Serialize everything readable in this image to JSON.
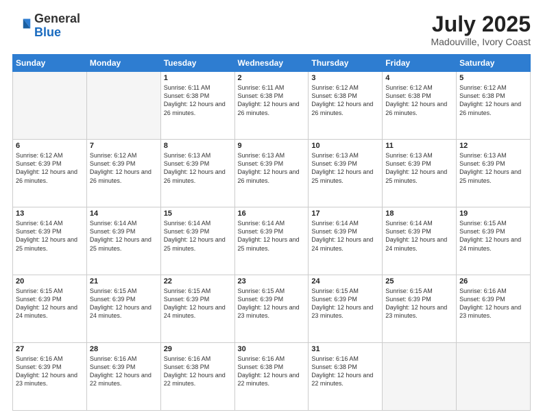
{
  "header": {
    "logo": {
      "general": "General",
      "blue": "Blue"
    },
    "title": "July 2025",
    "location": "Madouville, Ivory Coast"
  },
  "weekdays": [
    "Sunday",
    "Monday",
    "Tuesday",
    "Wednesday",
    "Thursday",
    "Friday",
    "Saturday"
  ],
  "weeks": [
    [
      {
        "day": null,
        "info": null
      },
      {
        "day": null,
        "info": null
      },
      {
        "day": "1",
        "info": "Sunrise: 6:11 AM\nSunset: 6:38 PM\nDaylight: 12 hours and 26 minutes."
      },
      {
        "day": "2",
        "info": "Sunrise: 6:11 AM\nSunset: 6:38 PM\nDaylight: 12 hours and 26 minutes."
      },
      {
        "day": "3",
        "info": "Sunrise: 6:12 AM\nSunset: 6:38 PM\nDaylight: 12 hours and 26 minutes."
      },
      {
        "day": "4",
        "info": "Sunrise: 6:12 AM\nSunset: 6:38 PM\nDaylight: 12 hours and 26 minutes."
      },
      {
        "day": "5",
        "info": "Sunrise: 6:12 AM\nSunset: 6:38 PM\nDaylight: 12 hours and 26 minutes."
      }
    ],
    [
      {
        "day": "6",
        "info": "Sunrise: 6:12 AM\nSunset: 6:39 PM\nDaylight: 12 hours and 26 minutes."
      },
      {
        "day": "7",
        "info": "Sunrise: 6:12 AM\nSunset: 6:39 PM\nDaylight: 12 hours and 26 minutes."
      },
      {
        "day": "8",
        "info": "Sunrise: 6:13 AM\nSunset: 6:39 PM\nDaylight: 12 hours and 26 minutes."
      },
      {
        "day": "9",
        "info": "Sunrise: 6:13 AM\nSunset: 6:39 PM\nDaylight: 12 hours and 26 minutes."
      },
      {
        "day": "10",
        "info": "Sunrise: 6:13 AM\nSunset: 6:39 PM\nDaylight: 12 hours and 25 minutes."
      },
      {
        "day": "11",
        "info": "Sunrise: 6:13 AM\nSunset: 6:39 PM\nDaylight: 12 hours and 25 minutes."
      },
      {
        "day": "12",
        "info": "Sunrise: 6:13 AM\nSunset: 6:39 PM\nDaylight: 12 hours and 25 minutes."
      }
    ],
    [
      {
        "day": "13",
        "info": "Sunrise: 6:14 AM\nSunset: 6:39 PM\nDaylight: 12 hours and 25 minutes."
      },
      {
        "day": "14",
        "info": "Sunrise: 6:14 AM\nSunset: 6:39 PM\nDaylight: 12 hours and 25 minutes."
      },
      {
        "day": "15",
        "info": "Sunrise: 6:14 AM\nSunset: 6:39 PM\nDaylight: 12 hours and 25 minutes."
      },
      {
        "day": "16",
        "info": "Sunrise: 6:14 AM\nSunset: 6:39 PM\nDaylight: 12 hours and 25 minutes."
      },
      {
        "day": "17",
        "info": "Sunrise: 6:14 AM\nSunset: 6:39 PM\nDaylight: 12 hours and 24 minutes."
      },
      {
        "day": "18",
        "info": "Sunrise: 6:14 AM\nSunset: 6:39 PM\nDaylight: 12 hours and 24 minutes."
      },
      {
        "day": "19",
        "info": "Sunrise: 6:15 AM\nSunset: 6:39 PM\nDaylight: 12 hours and 24 minutes."
      }
    ],
    [
      {
        "day": "20",
        "info": "Sunrise: 6:15 AM\nSunset: 6:39 PM\nDaylight: 12 hours and 24 minutes."
      },
      {
        "day": "21",
        "info": "Sunrise: 6:15 AM\nSunset: 6:39 PM\nDaylight: 12 hours and 24 minutes."
      },
      {
        "day": "22",
        "info": "Sunrise: 6:15 AM\nSunset: 6:39 PM\nDaylight: 12 hours and 24 minutes."
      },
      {
        "day": "23",
        "info": "Sunrise: 6:15 AM\nSunset: 6:39 PM\nDaylight: 12 hours and 23 minutes."
      },
      {
        "day": "24",
        "info": "Sunrise: 6:15 AM\nSunset: 6:39 PM\nDaylight: 12 hours and 23 minutes."
      },
      {
        "day": "25",
        "info": "Sunrise: 6:15 AM\nSunset: 6:39 PM\nDaylight: 12 hours and 23 minutes."
      },
      {
        "day": "26",
        "info": "Sunrise: 6:16 AM\nSunset: 6:39 PM\nDaylight: 12 hours and 23 minutes."
      }
    ],
    [
      {
        "day": "27",
        "info": "Sunrise: 6:16 AM\nSunset: 6:39 PM\nDaylight: 12 hours and 23 minutes."
      },
      {
        "day": "28",
        "info": "Sunrise: 6:16 AM\nSunset: 6:39 PM\nDaylight: 12 hours and 22 minutes."
      },
      {
        "day": "29",
        "info": "Sunrise: 6:16 AM\nSunset: 6:38 PM\nDaylight: 12 hours and 22 minutes."
      },
      {
        "day": "30",
        "info": "Sunrise: 6:16 AM\nSunset: 6:38 PM\nDaylight: 12 hours and 22 minutes."
      },
      {
        "day": "31",
        "info": "Sunrise: 6:16 AM\nSunset: 6:38 PM\nDaylight: 12 hours and 22 minutes."
      },
      {
        "day": null,
        "info": null
      },
      {
        "day": null,
        "info": null
      }
    ]
  ]
}
